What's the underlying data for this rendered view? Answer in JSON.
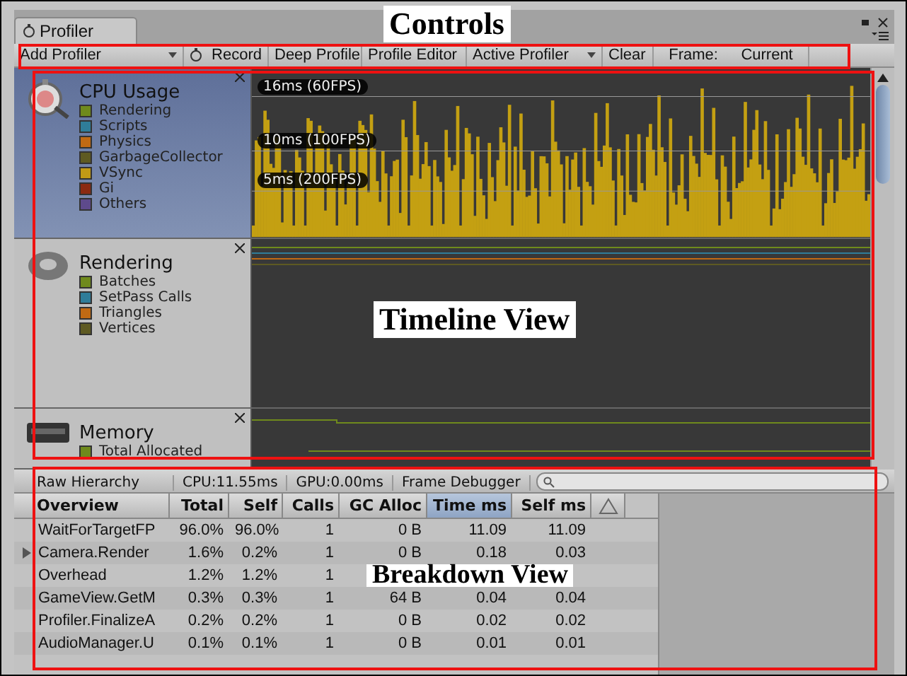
{
  "window": {
    "title": "Profiler"
  },
  "toolbar": [
    {
      "kind": "dropdown",
      "label": "Add Profiler"
    },
    {
      "kind": "record",
      "label": "Record"
    },
    {
      "kind": "button",
      "label": "Deep Profile"
    },
    {
      "kind": "button",
      "label": "Profile Editor"
    },
    {
      "kind": "dropdown",
      "label": "Active Profiler"
    },
    {
      "kind": "button",
      "label": "Clear"
    },
    {
      "kind": "frame",
      "label": "Frame:",
      "value": "Current"
    }
  ],
  "modules": [
    {
      "name": "CPU Usage",
      "selected": true,
      "legend": [
        {
          "label": "Rendering",
          "color": "#6f8a1c"
        },
        {
          "label": "Scripts",
          "color": "#2f7d99"
        },
        {
          "label": "Physics",
          "color": "#c06a14"
        },
        {
          "label": "GarbageCollector",
          "color": "#5e5a22"
        },
        {
          "label": "VSync",
          "color": "#c29a16"
        },
        {
          "label": "Gi",
          "color": "#8a2a12"
        },
        {
          "label": "Others",
          "color": "#5e4a8c"
        }
      ],
      "guides": [
        "16ms (60FPS)",
        "10ms (100FPS)",
        "5ms (200FPS)"
      ]
    },
    {
      "name": "Rendering",
      "selected": false,
      "legend": [
        {
          "label": "Batches",
          "color": "#6f8a1c"
        },
        {
          "label": "SetPass Calls",
          "color": "#2f7d99"
        },
        {
          "label": "Triangles",
          "color": "#c06a14"
        },
        {
          "label": "Vertices",
          "color": "#5e5a22"
        }
      ]
    },
    {
      "name": "Memory",
      "selected": false,
      "legend": [
        {
          "label": "Total Allocated",
          "color": "#6f8a1c"
        }
      ]
    }
  ],
  "breakdown": {
    "view": "Raw Hierarchy",
    "cpu": "CPU:11.55ms",
    "gpu": "GPU:0.00ms",
    "frame_debugger": "Frame Debugger",
    "columns": [
      {
        "label": "Overview",
        "selected": false
      },
      {
        "label": "Total",
        "selected": false
      },
      {
        "label": "Self",
        "selected": false
      },
      {
        "label": "Calls",
        "selected": false
      },
      {
        "label": "GC Alloc",
        "selected": false
      },
      {
        "label": "Time ms",
        "selected": true
      },
      {
        "label": "Self ms",
        "selected": false
      }
    ],
    "rows": [
      {
        "expandable": false,
        "cells": [
          "WaitForTargetFP",
          "96.0%",
          "96.0%",
          "1",
          "0 B",
          "11.09",
          "11.09"
        ]
      },
      {
        "expandable": true,
        "cells": [
          "Camera.Render",
          "1.6%",
          "0.2%",
          "1",
          "0 B",
          "0.18",
          "0.03"
        ]
      },
      {
        "expandable": false,
        "cells": [
          "Overhead",
          "1.2%",
          "1.2%",
          "1"
        ]
      },
      {
        "expandable": false,
        "cells": [
          "GameView.GetM",
          "0.3%",
          "0.3%",
          "1",
          "64 B",
          "0.04",
          "0.04"
        ]
      },
      {
        "expandable": false,
        "cells": [
          "Profiler.FinalizeA",
          "0.2%",
          "0.2%",
          "1",
          "0 B",
          "0.02",
          "0.02"
        ]
      },
      {
        "expandable": false,
        "cells": [
          "AudioManager.U",
          "0.1%",
          "0.1%",
          "1",
          "0 B",
          "0.01",
          "0.01"
        ]
      }
    ]
  },
  "annotations": [
    "Controls",
    "Timeline View",
    "Breakdown View"
  ]
}
